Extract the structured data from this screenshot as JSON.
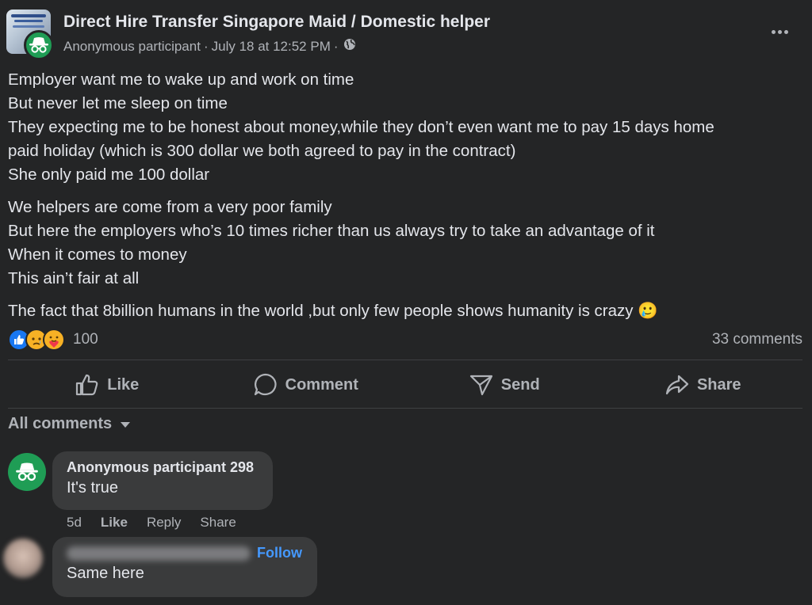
{
  "post": {
    "group_title": "Direct Hire Transfer Singapore Maid / Domestic helper",
    "author": "Anonymous participant",
    "separator": "·",
    "timestamp": "July 18 at 12:52 PM",
    "privacy_icon": "globe-icon",
    "body": {
      "paragraphs": [
        {
          "lines": [
            "Employer want me to wake up and work on time",
            "But never let me sleep on time",
            "They expecting me to be honest about money,while they don’t even want me to pay 15 days home",
            "paid holiday (which is 300 dollar we both agreed to pay in the contract)",
            "She only paid me 100 dollar"
          ]
        },
        {
          "lines": [
            "We helpers are come from a very poor family",
            "But here the employers who’s 10 times richer than us always try to take an advantage of it",
            "When it comes to money",
            "This ain’t fair at all"
          ]
        },
        {
          "lines": [
            "The fact that 8billion humans  in the world ,but only few people shows humanity  is crazy 🥲"
          ]
        }
      ]
    },
    "reactions": {
      "icons": [
        "like-reaction-icon",
        "sad-reaction-icon",
        "care-reaction-icon"
      ],
      "count": "100"
    },
    "comments_count": "33 comments"
  },
  "actions": {
    "like": "Like",
    "comment": "Comment",
    "send": "Send",
    "share": "Share"
  },
  "comments_filter": "All comments",
  "comments": [
    {
      "name": "Anonymous participant 298",
      "text": "It's true",
      "time": "5d",
      "like": "Like",
      "reply": "Reply",
      "share": "Share"
    },
    {
      "follow": "Follow",
      "text": "Same here"
    }
  ],
  "colors": {
    "background": "#242526",
    "bubble": "#3a3b3c",
    "text": "#e4e6eb",
    "muted": "#b0b3b8",
    "anon_green": "#1f9d55",
    "link_blue": "#4599ff"
  }
}
